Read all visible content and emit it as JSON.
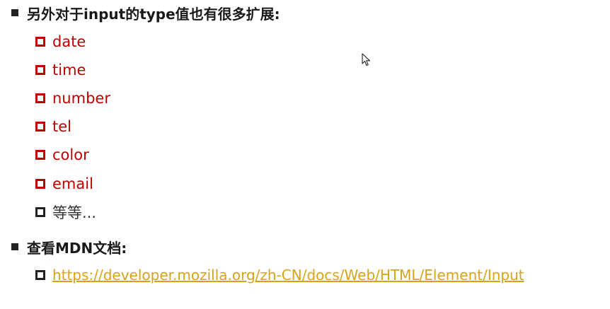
{
  "section1": {
    "heading": "另外对于input的type值也有很多扩展:",
    "items": [
      {
        "label": "date"
      },
      {
        "label": "time"
      },
      {
        "label": "number"
      },
      {
        "label": "tel"
      },
      {
        "label": "color"
      },
      {
        "label": "email"
      },
      {
        "label": "等等..."
      }
    ]
  },
  "section2": {
    "heading": "查看MDN文档:",
    "link": "https://developer.mozilla.org/zh-CN/docs/Web/HTML/Element/Input"
  },
  "colors": {
    "accent_red": "#c00000",
    "link_gold": "#d9a21b",
    "text_dark": "#1a1a1a"
  },
  "icons": {
    "level1_bullet": "filled-square-bullet-icon",
    "level2_bullet": "hollow-square-bullet-icon",
    "cursor": "mouse-pointer-icon"
  }
}
